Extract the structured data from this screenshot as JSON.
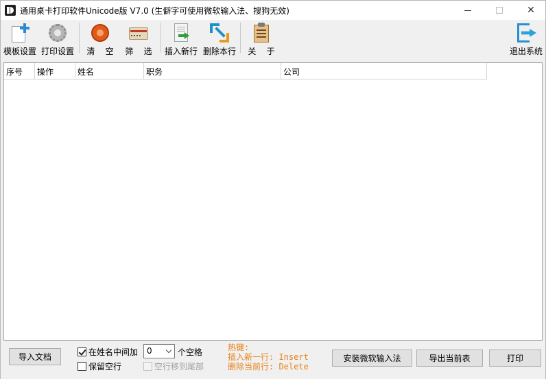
{
  "window": {
    "title": "通用桌卡打印软件Unicode版  V7.0  (生僻字可使用微软输入法、搜狗无效)",
    "minimize_label": "",
    "maximize_label": "",
    "close_label": "✕"
  },
  "toolbar": {
    "template_settings": "模板设置",
    "print_settings": "打印设置",
    "clear": "清    空",
    "filter": "筛    选",
    "insert_row": "插入新行",
    "delete_row": "删除本行",
    "about": "关    于",
    "exit": "退出系统"
  },
  "grid": {
    "columns": [
      "序号",
      "操作",
      "姓名",
      "职务",
      "公司"
    ]
  },
  "bottom": {
    "import_button": "导入文档",
    "insert_in_name_label": "在姓名中间加",
    "insert_in_name_checked": true,
    "space_count_value": "0",
    "space_unit_label": "个空格",
    "keep_empty_label": "保留空行",
    "keep_empty_checked": false,
    "move_empty_label": "空行移到尾部",
    "move_empty_checked": false,
    "hotkeys_title": "热键:",
    "hotkey_insert": "插入新一行: Insert",
    "hotkey_delete": "删除当前行: Delete",
    "install_ime_button": "安装微软输入法",
    "export_button": "导出当前表",
    "print_button": "打印"
  },
  "colors": {
    "hotkey_text": "#e8821a",
    "accent": "#2a8fd0"
  }
}
